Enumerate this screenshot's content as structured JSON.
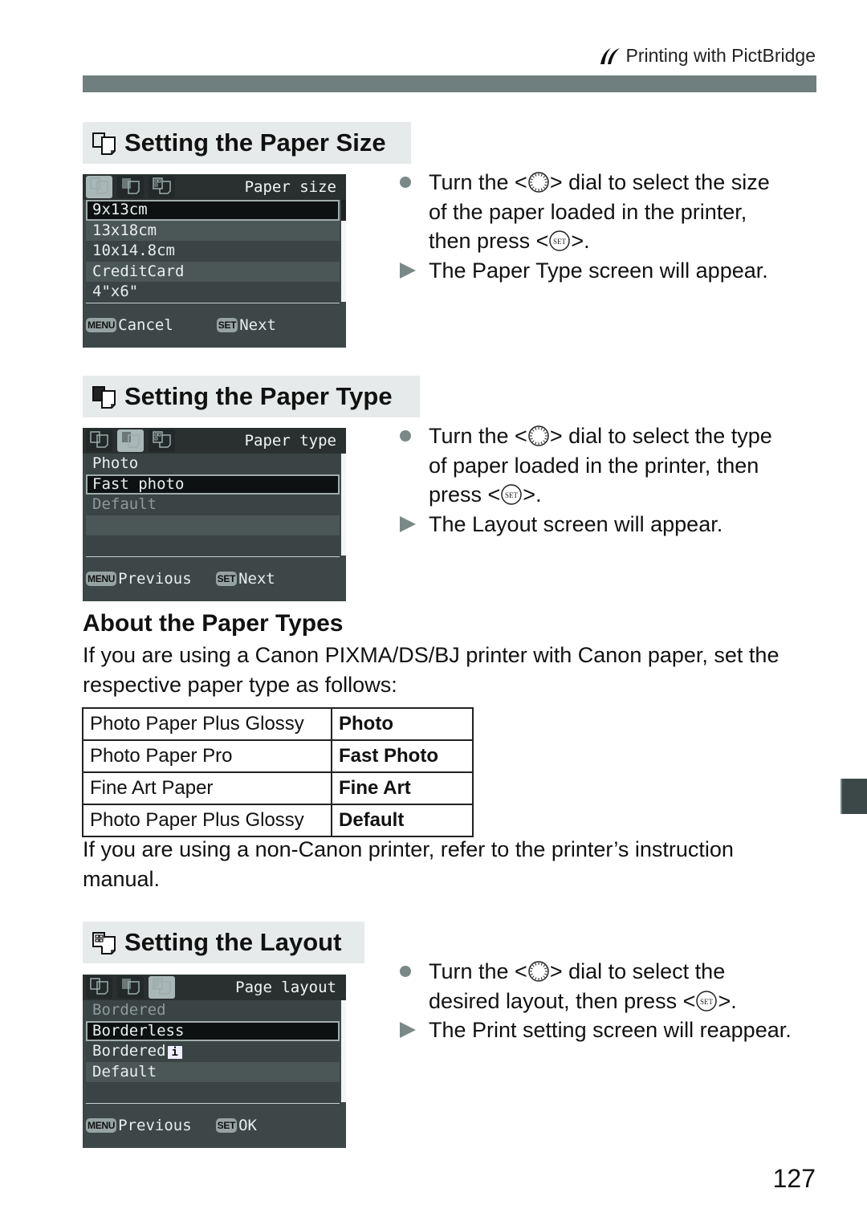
{
  "running_head": {
    "icon": "pictbridge-icon",
    "text": "Printing with PictBridge"
  },
  "sections": {
    "paper_size": {
      "heading": "Setting the Paper Size",
      "icon": "paper-size-icon",
      "lcd": {
        "title": "Paper size",
        "active_tab": 0,
        "items": [
          {
            "label": "9x13cm",
            "selected": true,
            "dimmed": false
          },
          {
            "label": "13x18cm",
            "selected": false,
            "dimmed": false
          },
          {
            "label": "10x14.8cm",
            "selected": false,
            "dimmed": false
          },
          {
            "label": "CreditCard",
            "selected": false,
            "dimmed": false
          },
          {
            "label": "4\"x6\"",
            "selected": false,
            "dimmed": false
          }
        ],
        "footer": {
          "left_key": "MENU",
          "left_label": "Cancel",
          "right_key": "SET",
          "right_label": "Next"
        }
      },
      "instructions": [
        {
          "type": "bullet",
          "parts": [
            "Turn the <",
            "dial",
            "> dial to select the size"
          ]
        },
        {
          "type": "cont",
          "parts": [
            "of the paper loaded in the printer,"
          ]
        },
        {
          "type": "cont",
          "parts": [
            "then press <",
            "set",
            ">."
          ]
        },
        {
          "type": "result",
          "parts": [
            "The Paper Type screen will appear."
          ]
        }
      ]
    },
    "paper_type": {
      "heading": "Setting the Paper Type",
      "icon": "paper-type-icon",
      "lcd": {
        "title": "Paper type",
        "active_tab": 1,
        "items": [
          {
            "label": "Photo",
            "selected": false,
            "dimmed": false
          },
          {
            "label": "Fast photo",
            "selected": true,
            "dimmed": false
          },
          {
            "label": "Default",
            "selected": false,
            "dimmed": true
          },
          {
            "label": "",
            "selected": false,
            "dimmed": false
          },
          {
            "label": "",
            "selected": false,
            "dimmed": false
          }
        ],
        "footer": {
          "left_key": "MENU",
          "left_label": "Previous",
          "right_key": "SET",
          "right_label": "Next"
        }
      },
      "instructions": [
        {
          "type": "bullet",
          "parts": [
            "Turn the <",
            "dial",
            "> dial to select the type"
          ]
        },
        {
          "type": "cont",
          "parts": [
            "of paper loaded in the printer, then"
          ]
        },
        {
          "type": "cont",
          "parts": [
            "press <",
            "set",
            ">."
          ]
        },
        {
          "type": "result",
          "parts": [
            "The Layout screen will appear."
          ]
        }
      ]
    },
    "about": {
      "heading": "About the Paper Types",
      "intro": "If you are using a Canon PIXMA/DS/BJ printer with Canon paper, set the respective paper type as follows:",
      "table": [
        [
          "Photo Paper Plus Glossy",
          "Photo"
        ],
        [
          "Photo Paper Pro",
          "Fast Photo"
        ],
        [
          "Fine Art Paper",
          "Fine Art"
        ],
        [
          "Photo Paper Plus Glossy",
          "Default"
        ]
      ],
      "outro": "If you are using a non-Canon printer, refer to the printer’s instruction manual."
    },
    "layout": {
      "heading": "Setting the Layout",
      "icon": "layout-icon",
      "lcd": {
        "title": "Page layout",
        "active_tab": 2,
        "items": [
          {
            "label": "Bordered",
            "selected": false,
            "dimmed": true
          },
          {
            "label": "Borderless",
            "selected": true,
            "dimmed": false
          },
          {
            "label": "Bordered",
            "selected": false,
            "dimmed": false,
            "info_badge": "i"
          },
          {
            "label": "Default",
            "selected": false,
            "dimmed": false
          },
          {
            "label": "",
            "selected": false,
            "dimmed": false
          }
        ],
        "footer": {
          "left_key": "MENU",
          "left_label": "Previous",
          "right_key": "SET",
          "right_label": "OK"
        }
      },
      "instructions": [
        {
          "type": "bullet",
          "parts": [
            "Turn the <",
            "dial",
            "> dial to select the"
          ]
        },
        {
          "type": "cont",
          "parts": [
            "desired layout, then press <",
            "set",
            ">."
          ]
        },
        {
          "type": "result",
          "parts": [
            "The Print setting screen will reappear."
          ]
        }
      ]
    }
  },
  "page_number": "127"
}
